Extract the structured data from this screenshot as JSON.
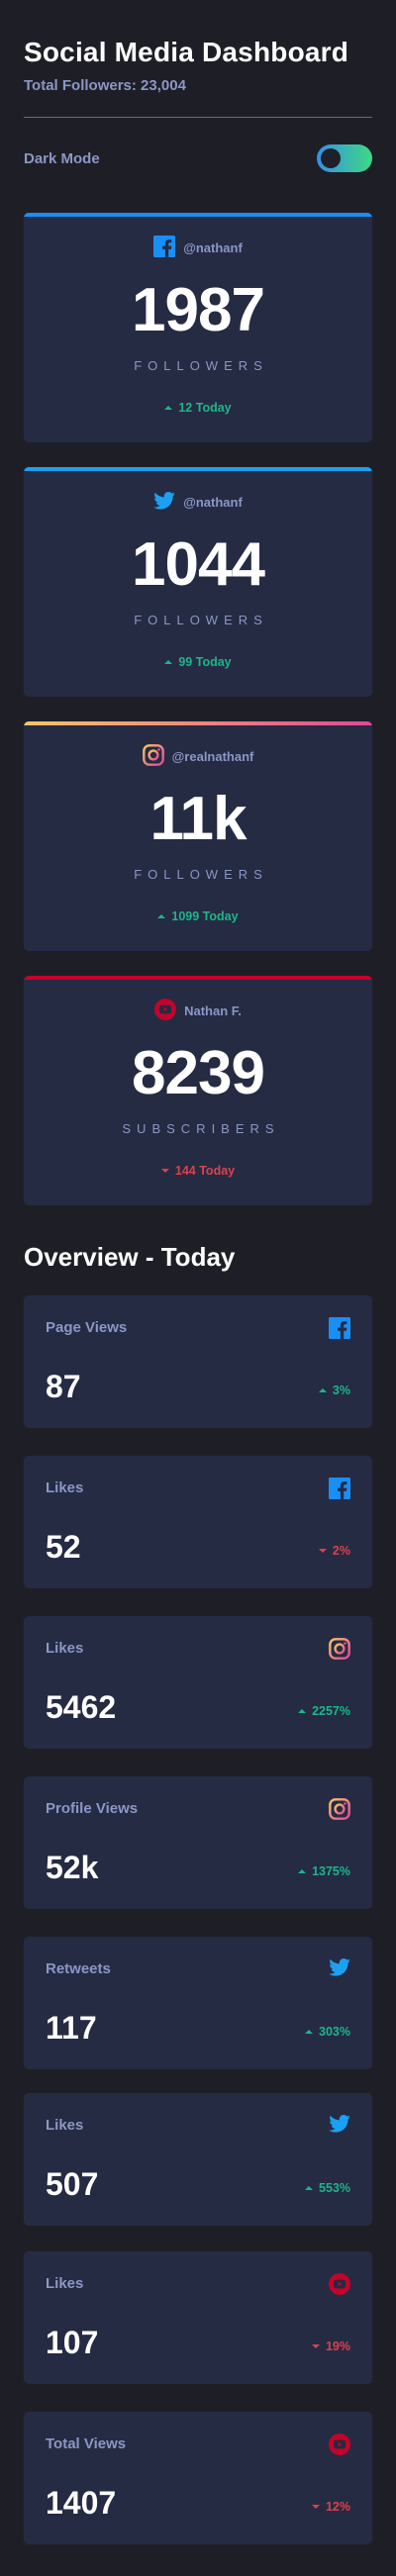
{
  "header": {
    "title": "Social Media Dashboard",
    "total_followers": "Total Followers: 23,004"
  },
  "theme_toggle": {
    "label": "Dark Mode",
    "on": true
  },
  "colors": {
    "background": "#1e1f26",
    "card": "#252b43",
    "muted_text": "#8b97c6",
    "up": "#1eb589",
    "down": "#dc414c",
    "facebook": "#198ff5",
    "twitter": "#1ca0f2",
    "instagram_gradient": [
      "#fdc468",
      "#df4996"
    ],
    "youtube": "#c4032a"
  },
  "follower_cards": [
    {
      "platform": "facebook",
      "icon": "facebook-icon",
      "handle": "@nathanf",
      "count": "1987",
      "unit": "FOLLOWERS",
      "today": "12 Today",
      "trend": "up"
    },
    {
      "platform": "twitter",
      "icon": "twitter-icon",
      "handle": "@nathanf",
      "count": "1044",
      "unit": "FOLLOWERS",
      "today": "99 Today",
      "trend": "up"
    },
    {
      "platform": "instagram",
      "icon": "instagram-icon",
      "handle": "@realnathanf",
      "count": "11k",
      "unit": "FOLLOWERS",
      "today": "1099 Today",
      "trend": "up"
    },
    {
      "platform": "youtube",
      "icon": "youtube-icon",
      "handle": "Nathan F.",
      "count": "8239",
      "unit": "SUBSCRIBERS",
      "today": "144 Today",
      "trend": "down"
    }
  ],
  "overview": {
    "title": "Overview - Today",
    "cards": [
      {
        "label": "Page Views",
        "platform": "facebook",
        "icon": "facebook-icon",
        "value": "87",
        "change": "3%",
        "trend": "up"
      },
      {
        "label": "Likes",
        "platform": "facebook",
        "icon": "facebook-icon",
        "value": "52",
        "change": "2%",
        "trend": "down"
      },
      {
        "label": "Likes",
        "platform": "instagram",
        "icon": "instagram-icon",
        "value": "5462",
        "change": "2257%",
        "trend": "up"
      },
      {
        "label": "Profile Views",
        "platform": "instagram",
        "icon": "instagram-icon",
        "value": "52k",
        "change": "1375%",
        "trend": "up"
      },
      {
        "label": "Retweets",
        "platform": "twitter",
        "icon": "twitter-icon",
        "value": "117",
        "change": "303%",
        "trend": "up"
      },
      {
        "label": "Likes",
        "platform": "twitter",
        "icon": "twitter-icon",
        "value": "507",
        "change": "553%",
        "trend": "up"
      },
      {
        "label": "Likes",
        "platform": "youtube",
        "icon": "youtube-icon",
        "value": "107",
        "change": "19%",
        "trend": "down"
      },
      {
        "label": "Total Views",
        "platform": "youtube",
        "icon": "youtube-icon",
        "value": "1407",
        "change": "12%",
        "trend": "down"
      }
    ]
  }
}
